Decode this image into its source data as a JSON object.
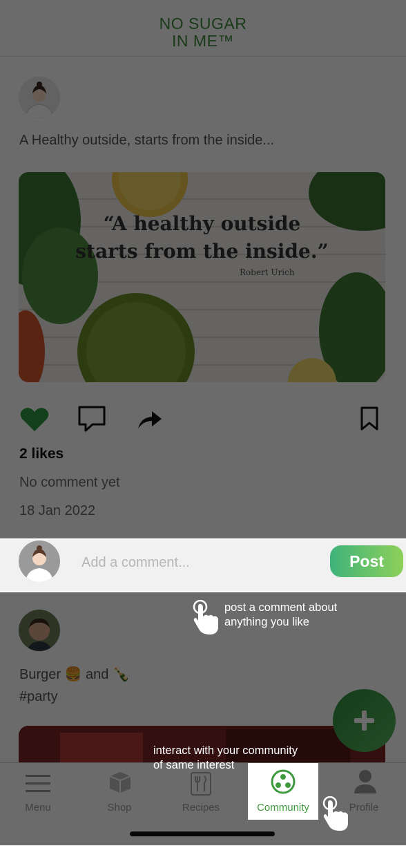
{
  "app": {
    "logo_line1": "NO SUGAR",
    "logo_line2": "IN ME™"
  },
  "post1": {
    "caption": "A Healthy outside, starts from the inside...",
    "image_quote_line1": "“A healthy outside",
    "image_quote_line2": "starts from the inside.”",
    "image_quote_author": "Robert Urich",
    "likes": "2 likes",
    "comments": "No comment yet",
    "date": "18 Jan 2022"
  },
  "comment_bar": {
    "placeholder": "Add a comment...",
    "post_label": "Post"
  },
  "post2": {
    "caption_line1": "Burger 🍔 and 🍾",
    "caption_line2": "#party"
  },
  "fab": {
    "label": "+"
  },
  "nav": {
    "items": [
      {
        "label": "Menu"
      },
      {
        "label": "Shop"
      },
      {
        "label": "Recipes"
      },
      {
        "label": "Community"
      },
      {
        "label": "Profile"
      }
    ]
  },
  "tips": {
    "comment_line1": "post a comment about",
    "comment_line2": "anything you like",
    "community_line1": "interact with your community",
    "community_line2": "of same interest"
  },
  "colors": {
    "brand_green": "#3f8a3f",
    "like_green": "#2f9a3f",
    "post_button": "#3fb37a"
  }
}
